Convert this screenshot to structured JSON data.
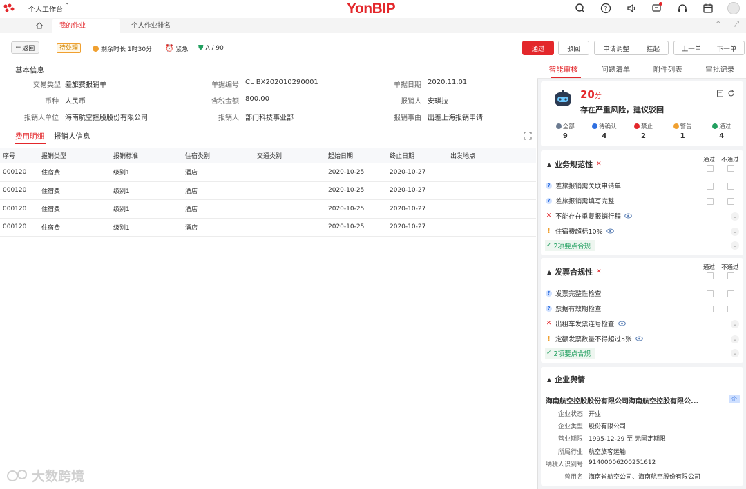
{
  "header": {
    "workspace_title": "个人工作台",
    "brand": "YonBIP",
    "icons": [
      "search-icon",
      "help-icon",
      "speaker-icon",
      "message-icon",
      "headset-icon",
      "calendar-icon",
      "avatar"
    ]
  },
  "tabs": {
    "active": "我的作业",
    "inactive": "个人作业排名",
    "right_controls": [
      "^",
      "⤢"
    ]
  },
  "toolbar": {
    "back_label": "返回",
    "status": "待处理",
    "remaining": "剩余时长 1时30分",
    "urgency": "紧急",
    "grade": "A / 90",
    "btn_pass": "通过",
    "btn_reject": "驳回",
    "btn_adjust": "申请调整",
    "btn_suspend": "挂起",
    "btn_prev": "上一单",
    "btn_next": "下一单"
  },
  "basic_info": {
    "title": "基本信息",
    "fields": [
      {
        "label": "交易类型",
        "value": "差旅费报销单"
      },
      {
        "label": "单据编号",
        "value": "CL BX202010290001"
      },
      {
        "label": "单据日期",
        "value": "2020.11.01"
      },
      {
        "label": "币种",
        "value": "人民币"
      },
      {
        "label": "含税金额",
        "value": "800.00"
      },
      {
        "label": "报销人",
        "value": "安琪拉"
      },
      {
        "label": "报销人单位",
        "value": "海南航空控股股份有限公司"
      },
      {
        "label": "报销人",
        "value": "部门科技事业部"
      },
      {
        "label": "报销事由",
        "value": "出差上海报销申请"
      }
    ]
  },
  "detail_tabs": {
    "active": "费用明细",
    "inactive": "报销人信息"
  },
  "table": {
    "columns": [
      "序号",
      "报销类型",
      "报销标准",
      "住宿类别",
      "交通类别",
      "起始日期",
      "终止日期",
      "出发地点"
    ],
    "rows": [
      [
        "000120",
        "住宿费",
        "级别1",
        "酒店",
        "",
        "2020-10-25",
        "2020-10-27",
        ""
      ],
      [
        "000120",
        "住宿费",
        "级别1",
        "酒店",
        "",
        "2020-10-25",
        "2020-10-27",
        ""
      ],
      [
        "000120",
        "住宿费",
        "级别1",
        "酒店",
        "",
        "2020-10-25",
        "2020-10-27",
        ""
      ],
      [
        "000120",
        "住宿费",
        "级别1",
        "酒店",
        "",
        "2020-10-25",
        "2020-10-27",
        ""
      ]
    ]
  },
  "right_panel": {
    "tabs": [
      "智能审核",
      "问题清单",
      "附件列表",
      "审批记录"
    ],
    "score_value": "20",
    "score_unit": "分",
    "risk_text": "存在严重风险，建议驳回",
    "stats": [
      {
        "label": "全部",
        "count": "9",
        "color": "#6b7a90"
      },
      {
        "label": "待确认",
        "count": "4",
        "color": "#2f6fe0"
      },
      {
        "label": "禁止",
        "count": "2",
        "color": "#e3272b"
      },
      {
        "label": "警告",
        "count": "1",
        "color": "#f0a030"
      },
      {
        "label": "通过",
        "count": "4",
        "color": "#22a060"
      }
    ],
    "col_pass": "通过",
    "col_fail": "不通过",
    "sections": [
      {
        "title": "业务规范性",
        "rules": [
          {
            "type": "q",
            "text": "差旅报销需关联申请单"
          },
          {
            "type": "q",
            "text": "差旅报销需填写完整"
          },
          {
            "type": "x",
            "text": "不能存在重复报销行程"
          },
          {
            "type": "w",
            "text": "住宿费超标10%"
          }
        ],
        "ok_text": "2项要点合规"
      },
      {
        "title": "发票合规性",
        "rules": [
          {
            "type": "q",
            "text": "发票完整性检查"
          },
          {
            "type": "q",
            "text": "票据有效期检查"
          },
          {
            "type": "x",
            "text": "出租车发票连号检查"
          },
          {
            "type": "w",
            "text": "定额发票数量不得超过5张"
          }
        ],
        "ok_text": "2项要点合规"
      }
    ],
    "company": {
      "title": "企业舆情",
      "name": "海南航空控股股份有限公司海南航空控股有限公...",
      "badge": "企",
      "fields": [
        {
          "label": "企业状态",
          "value": "开业"
        },
        {
          "label": "企业类型",
          "value": "股份有限公司"
        },
        {
          "label": "营业期限",
          "value": "1995-12-29 至 无固定期限"
        },
        {
          "label": "所属行业",
          "value": "航空旅客运输"
        },
        {
          "label": "纳税人识别号",
          "value": "91400006200251612"
        },
        {
          "label": "曾用名",
          "value": "海南省航空公司、海南航空股份有限公司"
        }
      ]
    }
  },
  "watermark": "大数跨境"
}
